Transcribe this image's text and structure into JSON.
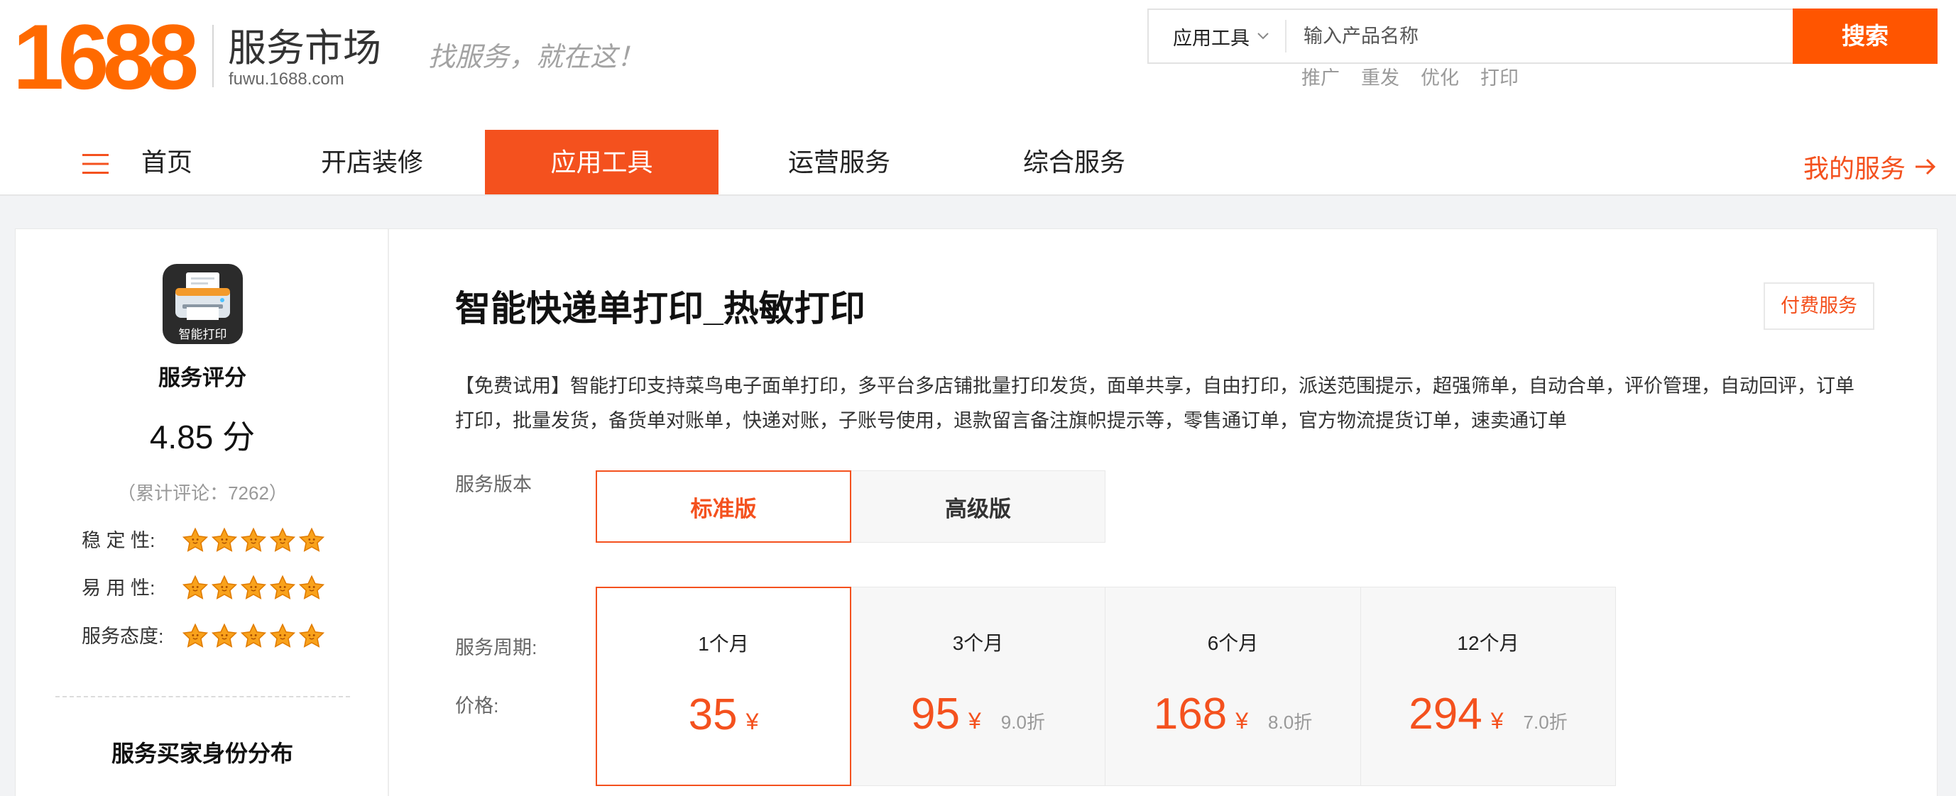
{
  "header": {
    "logo": "1688",
    "site_name": "服务市场",
    "site_url": "fuwu.1688.com",
    "slogan": "找服务，就在这！",
    "search": {
      "category": "应用工具",
      "placeholder": "输入产品名称",
      "button": "搜索",
      "hot_words": [
        "推广",
        "重发",
        "优化",
        "打印"
      ]
    }
  },
  "nav": {
    "menu_icon": "menu-icon",
    "items": [
      {
        "label": "首页"
      },
      {
        "label": "开店装修"
      },
      {
        "label": "应用工具",
        "active": true
      },
      {
        "label": "运营服务"
      },
      {
        "label": "综合服务"
      }
    ],
    "my_services": "我的服务",
    "my_services_icon": "arrow-right-icon"
  },
  "sidebar": {
    "app_icon": "printer-icon",
    "app_icon_label": "智能打印",
    "rating_title": "服务评分",
    "score": "4.85 分",
    "reviews": "（累计评论：7262）",
    "ratings": [
      {
        "label": "稳 定 性:",
        "stars": 5
      },
      {
        "label": "易 用 性:",
        "stars": 5
      },
      {
        "label": "服务态度:",
        "stars": 5
      }
    ],
    "buyer_distribution_title": "服务买家身份分布"
  },
  "product": {
    "title": "智能快递单打印_热敏打印",
    "badge": "付费服务",
    "description": "【免费试用】智能打印支持菜鸟电子面单打印，多平台多店铺批量打印发货，面单共享，自由打印，派送范围提示，超强筛单，自动合单，评价管理，自动回评，订单打印，批量发货，备货单对账单，快递对账，子账号使用，退款留言备注旗帜提示等，零售通订单，官方物流提货订单，速卖通订单",
    "version_label": "服务版本",
    "versions": [
      {
        "label": "标准版",
        "selected": true
      },
      {
        "label": "高级版"
      }
    ],
    "period_label": "服务周期:",
    "price_label": "价格:",
    "currency": "¥",
    "periods": [
      {
        "period": "1个月",
        "price": "35",
        "selected": true
      },
      {
        "period": "3个月",
        "price": "95",
        "discount": "9.0折"
      },
      {
        "period": "6个月",
        "price": "168",
        "discount": "8.0折"
      },
      {
        "period": "12个月",
        "price": "294",
        "discount": "7.0折"
      }
    ]
  },
  "colors": {
    "accent": "#f4511e",
    "logo": "#ff6a00",
    "search_button": "#ff5500",
    "star": "#f9a21b"
  }
}
